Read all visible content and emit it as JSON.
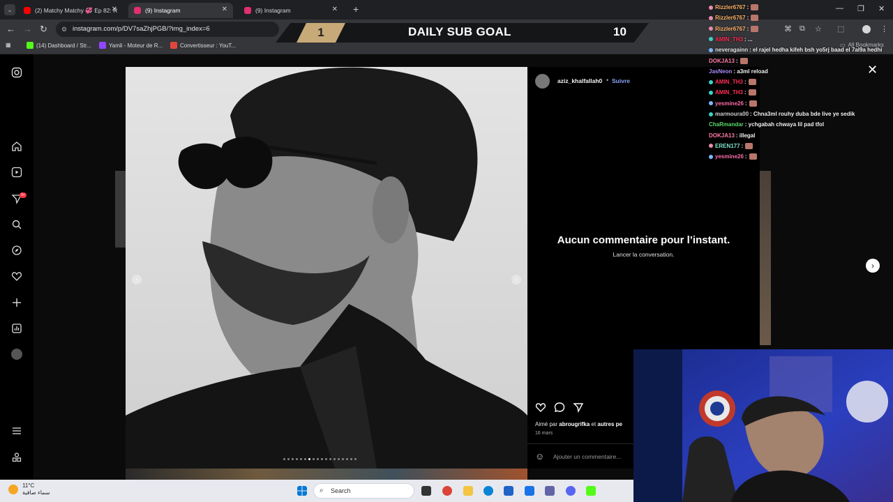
{
  "browser": {
    "tabs": [
      {
        "label": "(2) Matchy Matchy 💞 Ep 82: R",
        "favicon_color": "#ff0000",
        "active": false
      },
      {
        "label": "(9) Instagram",
        "favicon_color": "#e1306c",
        "active": true
      },
      {
        "label": "(9) Instagram",
        "favicon_color": "#e1306c",
        "active": false
      }
    ],
    "url": "instagram.com/p/DV7saZhjPGB/?img_index=6",
    "bookmarks": [
      {
        "label": "(14) Dashboard / Str...",
        "color": "#53fc18"
      },
      {
        "label": "Yamli - Moteur de R...",
        "color": "#9146ff"
      },
      {
        "label": "Convertisseur : YouT...",
        "color": "#e0473b"
      }
    ],
    "all_bookmarks_label": "All Bookmarks"
  },
  "sub_goal": {
    "current": "1",
    "title": "DAILY SUB GOAL",
    "target": "10"
  },
  "post": {
    "username": "aziz_khalfallah0",
    "separator": "•",
    "follow_label": "Suivre",
    "empty_title": "Aucun commentaire pour l’instant.",
    "empty_subtitle": "Lancer la conversation.",
    "liked_prefix": "Aimé par",
    "liked_by": "abrougrifka",
    "liked_suffix_and": "et",
    "liked_others": "autres pe",
    "date": "16 mars",
    "comment_placeholder": "Ajouter un commentaire...",
    "carousel_dots": 18,
    "active_dot": 6
  },
  "chat": [
    {
      "user": "Rizzler6767",
      "color": "#ffb36b",
      "text": ":",
      "badge": "#e98dad"
    },
    {
      "user": "Rizzler6767",
      "color": "#ffb36b",
      "text": ":",
      "badge": "#e98dad"
    },
    {
      "user": "Rizzler6767",
      "color": "#ffb36b",
      "text": ":",
      "badge": "#e98dad"
    },
    {
      "user": "AMIN_TH3",
      "color": "#ff2d55",
      "text": ": ...",
      "badge": "#3ad3c8"
    },
    {
      "user": "neveragainn",
      "color": "#e6e6e6",
      "text": ": el rajel hedha kifeh bsh yo5rj baad el 7al9a hedhi",
      "badge": "#7ab8ff"
    },
    {
      "user": "DOKJA13",
      "color": "#ff7aa8",
      "text": ":",
      "badge": ""
    },
    {
      "user": "JasNeon",
      "color": "#a78bfa",
      "text": ": a3ml reload",
      "badge": ""
    },
    {
      "user": "AMIN_TH3",
      "color": "#ff2d55",
      "text": ":",
      "badge": "#3ad3c8"
    },
    {
      "user": "AMIN_TH3",
      "color": "#ff2d55",
      "text": ":",
      "badge": "#3ad3c8"
    },
    {
      "user": "yesmine26",
      "color": "#ff6fa8",
      "text": ":",
      "badge": "#7ab8ff"
    },
    {
      "user": "marmoura00",
      "color": "#cfcfcf",
      "text": ": Chna3ml rouhy duba bde live ye sedik",
      "badge": "#3ad3c8"
    },
    {
      "user": "ChaRmandar",
      "color": "#5bd96b",
      "text": ": ychgabah chwaya lil pad tfol",
      "badge": ""
    },
    {
      "user": "DOKJA13",
      "color": "#ff7aa8",
      "text": ": illegal",
      "badge": ""
    },
    {
      "user": "EREN177",
      "color": "#7fe6c9",
      "text": ":",
      "badge": "#e98dad"
    },
    {
      "user": "yesmine26",
      "color": "#ff6fa8",
      "text": ":",
      "badge": "#7ab8ff"
    }
  ],
  "taskbar": {
    "temperature": "11°C",
    "weather_text": "سماء صافية",
    "search_placeholder": "Search"
  },
  "icons": [
    "instagram-logo-icon",
    "home-icon",
    "reels-icon",
    "messages-icon",
    "search-icon",
    "explore-icon",
    "notifications-icon",
    "create-icon",
    "dashboard-icon",
    "profile-icon",
    "menu-icon",
    "meta-icon"
  ]
}
